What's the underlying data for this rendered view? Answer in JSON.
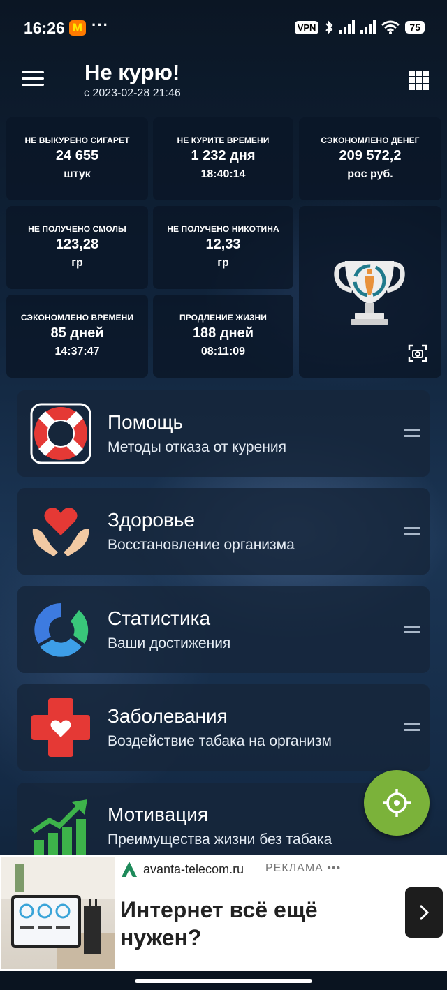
{
  "status_bar": {
    "time": "16:26",
    "app_icon_letter": "M",
    "dots": "···",
    "vpn": "VPN",
    "battery": "75"
  },
  "header": {
    "title": "Не курю!",
    "subtitle": "с 2023-02-28 21:46"
  },
  "stats": [
    {
      "label": "НЕ ВЫКУРЕНО СИГАРЕТ",
      "value": "24 655",
      "unit": "штук"
    },
    {
      "label": "НЕ КУРИТЕ ВРЕМЕНИ",
      "value": "1 232 дня",
      "unit": "18:40:14"
    },
    {
      "label": "СЭКОНОМЛЕНО ДЕНЕГ",
      "value": "209 572,2",
      "unit": "рос руб."
    },
    {
      "label": "НЕ ПОЛУЧЕНО СМОЛЫ",
      "value": "123,28",
      "unit": "гр"
    },
    {
      "label": "НЕ ПОЛУЧЕНО НИКОТИНА",
      "value": "12,33",
      "unit": "гр"
    },
    {
      "label": "СЭКОНОМЛЕНО ВРЕМЕНИ",
      "value": "85 дней",
      "unit": "14:37:47"
    },
    {
      "label": "ПРОДЛЕНИЕ ЖИЗНИ",
      "value": "188 дней",
      "unit": "08:11:09"
    }
  ],
  "menu": [
    {
      "title": "Помощь",
      "subtitle": "Методы отказа от курения",
      "icon": "lifebuoy-icon"
    },
    {
      "title": "Здоровье",
      "subtitle": "Восстановление организма",
      "icon": "heart-hands-icon"
    },
    {
      "title": "Статистика",
      "subtitle": "Ваши достижения",
      "icon": "ring-chart-icon"
    },
    {
      "title": "Заболевания",
      "subtitle": "Воздействие табака на организм",
      "icon": "medical-cross-icon"
    },
    {
      "title": "Мотивация",
      "subtitle": "Преимущества жизни без табака",
      "icon": "growth-chart-icon"
    }
  ],
  "ad": {
    "domain": "avanta-telecom.ru",
    "label": "РЕКЛАМА •••",
    "headline": "Интернет всё ещё нужен?"
  },
  "colors": {
    "fab": "#7bb23a",
    "lifebuoy_red": "#e53935",
    "heart_red": "#e53935",
    "stat_blue": "#3d7be0",
    "stat_green": "#39c77a"
  }
}
